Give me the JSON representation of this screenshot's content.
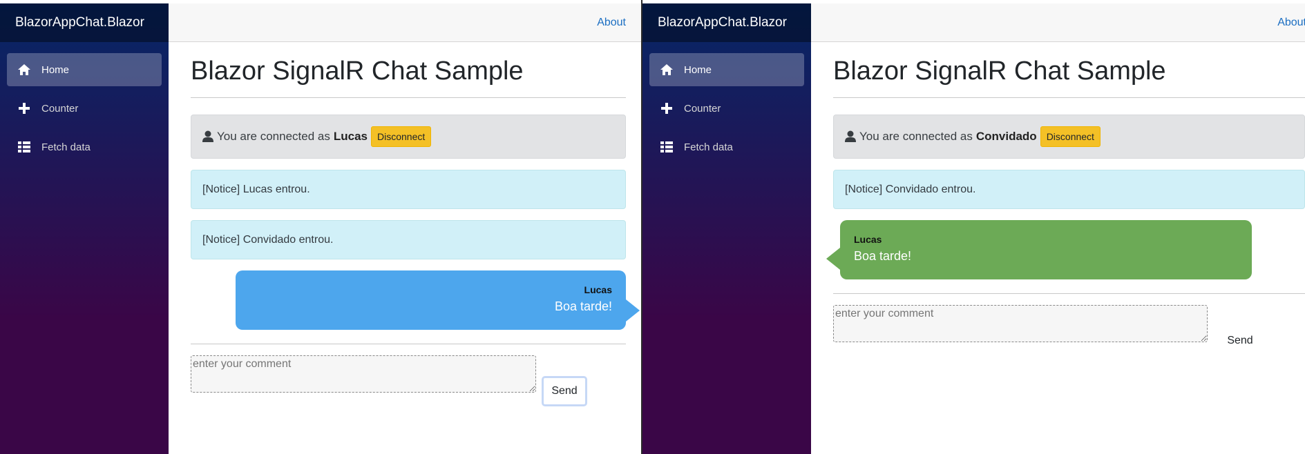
{
  "windows": [
    {
      "brand": "BlazorAppChat.Blazor",
      "nav": [
        {
          "label": "Home",
          "icon": "home-icon",
          "active": true
        },
        {
          "label": "Counter",
          "icon": "plus-icon",
          "active": false
        },
        {
          "label": "Fetch data",
          "icon": "list-icon",
          "active": false
        }
      ],
      "about": "About",
      "title": "Blazor SignalR Chat Sample",
      "connection": {
        "prefix": "You are connected as",
        "user": "Lucas",
        "disconnect": "Disconnect"
      },
      "notices": [
        "[Notice] Lucas entrou.",
        "[Notice] Convidado entrou."
      ],
      "message": {
        "sender": "Lucas",
        "text": "Boa tarde!",
        "own": true
      },
      "comment_placeholder": "enter your comment",
      "send_label": "Send"
    },
    {
      "brand": "BlazorAppChat.Blazor",
      "nav": [
        {
          "label": "Home",
          "icon": "home-icon",
          "active": true
        },
        {
          "label": "Counter",
          "icon": "plus-icon",
          "active": false
        },
        {
          "label": "Fetch data",
          "icon": "list-icon",
          "active": false
        }
      ],
      "about": "About",
      "title": "Blazor SignalR Chat Sample",
      "connection": {
        "prefix": "You are connected as",
        "user": "Convidado",
        "disconnect": "Disconnect"
      },
      "notices": [
        "[Notice] Convidado entrou."
      ],
      "message": {
        "sender": "Lucas",
        "text": "Boa tarde!",
        "own": false
      },
      "comment_placeholder": "enter your comment",
      "send_label": "Send"
    }
  ],
  "colors": {
    "own_bubble": "#4da6ed",
    "other_bubble": "#6caa56",
    "disconnect": "#f4c026",
    "notice_bg": "#d1f0f8",
    "link": "#1b6ec2"
  }
}
